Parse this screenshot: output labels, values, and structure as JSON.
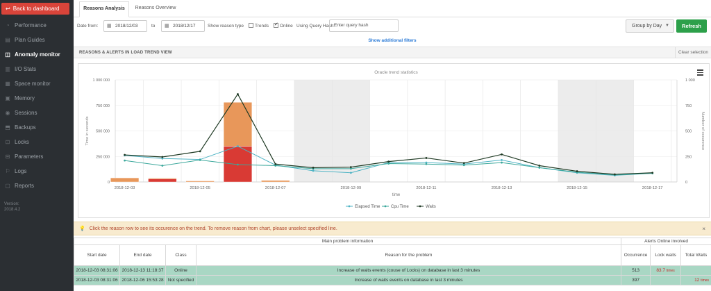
{
  "sidebar": {
    "back_label": "Back to dashboard",
    "items": [
      {
        "label": "Performance",
        "icon": "◔"
      },
      {
        "label": "Plan Guides",
        "icon": "▤"
      },
      {
        "label": "Anomaly monitor",
        "icon": "◫"
      },
      {
        "label": "I/O Stats",
        "icon": "▥"
      },
      {
        "label": "Space monitor",
        "icon": "▦"
      },
      {
        "label": "Memory",
        "icon": "▣"
      },
      {
        "label": "Sessions",
        "icon": "◉"
      },
      {
        "label": "Backups",
        "icon": "⬒"
      },
      {
        "label": "Locks",
        "icon": "⊡"
      },
      {
        "label": "Parameters",
        "icon": "⊟"
      },
      {
        "label": "Logs",
        "icon": "⚐"
      },
      {
        "label": "Reports",
        "icon": "▢"
      }
    ],
    "version_label": "Version:",
    "version": "2018.4.2"
  },
  "tabs": [
    "Reasons Analysis",
    "Reasons Overview"
  ],
  "filters": {
    "date_from_label": "Date from:",
    "date_from": "2018/12/03",
    "to_label": "to",
    "date_to": "2018/12/17",
    "reason_type_label": "Show reason type",
    "trends_label": "Trends",
    "online_label": "Online",
    "query_hash_label": "Using Query Hash:",
    "query_hash_placeholder": "Enter query hash",
    "group_by": "Group by Day",
    "refresh_label": "Refresh",
    "additional_filters": "Show additional filters"
  },
  "section": {
    "title": "REASONS & ALERTS IN LOAD TREND VIEW",
    "clear_selection": "Clear selection"
  },
  "chart_data": {
    "type": "line",
    "title": "Oracle trend statistics",
    "xlabel": "time",
    "ylabel": "Time in seconds",
    "y2label": "Number of occurence",
    "x": [
      "2018-12-03",
      "2018-12-04",
      "2018-12-05",
      "2018-12-06",
      "2018-12-07",
      "2018-12-08",
      "2018-12-09",
      "2018-12-10",
      "2018-12-11",
      "2018-12-12",
      "2018-12-13",
      "2018-12-14",
      "2018-12-15",
      "2018-12-16",
      "2018-12-17"
    ],
    "xtick_labels": [
      "2018-12-03",
      "2018-12-05",
      "2018-12-07",
      "2018-12-09",
      "2018-12-11",
      "2018-12-13",
      "2018-12-15",
      "2018-12-17"
    ],
    "ylim": [
      0,
      1000000
    ],
    "yticks": [
      "0",
      "250 000",
      "500 000",
      "750 000",
      "1 000 000"
    ],
    "y2lim": [
      0,
      1000
    ],
    "y2ticks": [
      "0",
      "250",
      "500",
      "750",
      "1 000"
    ],
    "series": [
      {
        "name": "Elapsed Time",
        "color": "#4db3c4",
        "values": [
          260000,
          230000,
          220000,
          350000,
          165000,
          110000,
          90000,
          190000,
          190000,
          175000,
          215000,
          140000,
          90000,
          65000,
          85000
        ]
      },
      {
        "name": "Cpu Time",
        "color": "#3aa79b",
        "values": [
          210000,
          160000,
          215000,
          170000,
          160000,
          130000,
          130000,
          180000,
          175000,
          165000,
          190000,
          140000,
          95000,
          70000,
          85000
        ]
      },
      {
        "name": "Waits",
        "color": "#1f3a24",
        "values": [
          265000,
          245000,
          300000,
          860000,
          175000,
          140000,
          145000,
          200000,
          235000,
          185000,
          270000,
          160000,
          105000,
          75000,
          90000
        ]
      }
    ],
    "occurrence_bars": [
      {
        "x": "2018-12-03",
        "segments": [
          {
            "value": 40,
            "color": "#e8975a"
          }
        ]
      },
      {
        "x": "2018-12-04",
        "segments": [
          {
            "value": 30,
            "color": "#d93a34"
          },
          {
            "value": 8,
            "color": "#e8975a"
          }
        ]
      },
      {
        "x": "2018-12-05",
        "segments": [
          {
            "value": 10,
            "color": "#e8975a"
          }
        ]
      },
      {
        "x": "2018-12-06",
        "segments": [
          {
            "value": 350,
            "color": "#d93a34"
          },
          {
            "value": 430,
            "color": "#e8975a"
          }
        ]
      },
      {
        "x": "2018-12-07",
        "segments": [
          {
            "value": 15,
            "color": "#e8975a"
          }
        ]
      }
    ],
    "shaded_ranges": [
      [
        "2018-12-08",
        "2018-12-09"
      ],
      [
        "2018-12-15",
        "2018-12-16"
      ]
    ],
    "legend_placement": "bottom-center"
  },
  "alert": {
    "text": "Click the reason row to see its occurence on the trend. To remove reason from chart, please unselect specified line.",
    "close": "×"
  },
  "table": {
    "group_main": "Main problem information",
    "group_alerts": "Alerts Online involved",
    "headers": [
      "Start date",
      "End date",
      "Class",
      "Reason for the problem",
      "Occurrence",
      "Lock waits",
      "Total Waits"
    ],
    "times_label": "times",
    "rows": [
      {
        "start": "2018-12-03 08:31:06",
        "end": "2018-12-13 11:18:37",
        "class": "Online",
        "reason": "Increase of waits events (couse of Locks) on database in last 3 minutes",
        "occurrence": "513",
        "lock_waits": "83.7",
        "total_waits": ""
      },
      {
        "start": "2018-12-03 08:31:06",
        "end": "2018-12-06 15:53:28",
        "class": "Not specified",
        "reason": "Increase of waits events on database in last 3 minutes",
        "occurrence": "397",
        "lock_waits": "",
        "total_waits": "12"
      }
    ]
  }
}
